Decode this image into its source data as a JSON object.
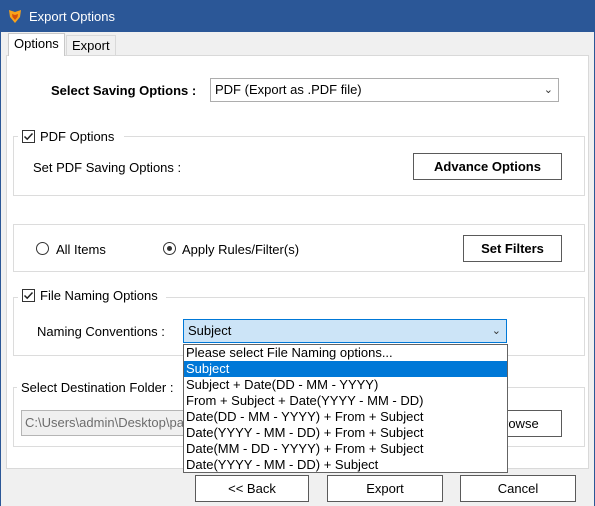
{
  "window": {
    "title": "Export Options",
    "accent": "#2b5797"
  },
  "tabs": [
    {
      "label": "Options",
      "active": true
    },
    {
      "label": "Export",
      "active": false
    }
  ],
  "saving": {
    "label": "Select Saving Options :",
    "selected": "PDF (Export as .PDF file)"
  },
  "pdf_options": {
    "checkbox_label": "PDF Options",
    "checked": true,
    "set_label": "Set PDF Saving Options :",
    "advance_button": "Advance Options"
  },
  "filters": {
    "all_items": "All Items",
    "apply_rules": "Apply Rules/Filter(s)",
    "selected": "apply_rules",
    "set_filters_button": "Set Filters"
  },
  "file_naming": {
    "checkbox_label": "File Naming Options",
    "checked": true,
    "conventions_label": "Naming Conventions :",
    "selected": "Subject",
    "options": [
      "Please select File Naming options...",
      "Subject",
      "Subject + Date(DD - MM - YYYY)",
      "From + Subject + Date(YYYY - MM - DD)",
      "Date(DD - MM - YYYY) + From + Subject",
      "Date(YYYY - MM - DD) + From + Subject",
      "Date(MM - DD - YYYY) + From + Subject",
      "Date(YYYY - MM - DD) + Subject"
    ],
    "highlighted_index": 1
  },
  "destination": {
    "label": "Select Destination Folder :",
    "path": "C:\\Users\\admin\\Desktop\\pa",
    "browse_button": "Browse",
    "browse_visible": "rowse"
  },
  "footer": {
    "back_button": "<< Back",
    "export_button": "Export",
    "cancel_button": "Cancel"
  }
}
